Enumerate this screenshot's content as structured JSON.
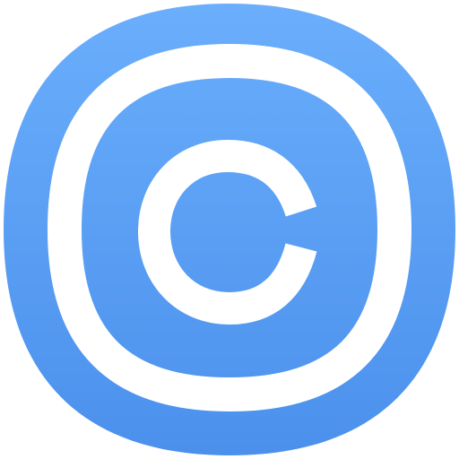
{
  "icon": {
    "name": "copyright-icon",
    "glyph": "C",
    "colors": {
      "tile_top": "#6aaefc",
      "tile_bottom": "#4b90ec",
      "foreground": "#ffffff"
    }
  }
}
